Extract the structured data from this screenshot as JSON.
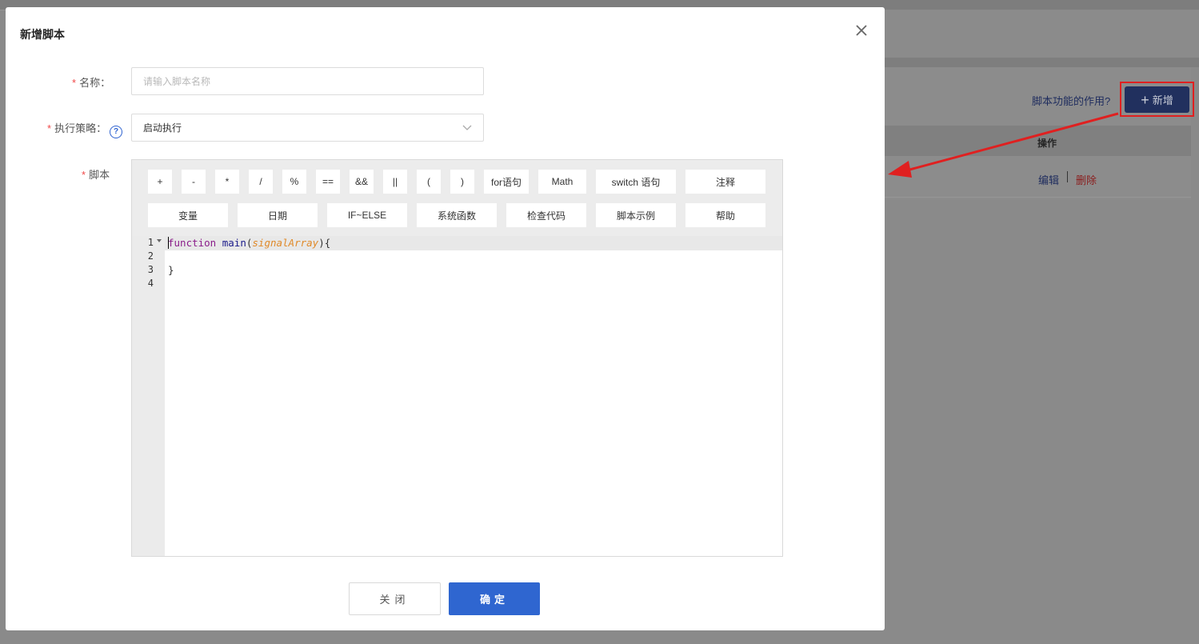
{
  "modal": {
    "title": "新增脚本",
    "close_icon": "close-icon"
  },
  "form": {
    "name_label": "名称：",
    "name_placeholder": "请输入脚本名称",
    "name_value": "",
    "strategy_label": "执行策略：",
    "strategy_help": "?",
    "strategy_value": "启动执行",
    "script_label": "脚本",
    "required_mark": "*"
  },
  "toolbar": {
    "row1": [
      "+",
      "-",
      "*",
      "/",
      "%",
      "==",
      "&&",
      "||",
      "(",
      ")",
      "for语句",
      "Math",
      "switch 语句",
      "注释"
    ],
    "row2": [
      "变量",
      "日期",
      "IF~ELSE",
      "系统函数",
      "检查代码",
      "脚本示例",
      "帮助"
    ]
  },
  "editor": {
    "line_numbers": [
      "1",
      "2",
      "3",
      "4"
    ],
    "code": {
      "kw_function": "function",
      "fn_main": "main",
      "open_paren": "(",
      "param": "signalArray",
      "close_paren_brace": "){",
      "line3": "}"
    }
  },
  "footer": {
    "close_label": "关闭",
    "ok_label": "确定"
  },
  "background": {
    "help_link": "脚本功能的作用?",
    "add_button": "新增",
    "column_operation": "操作",
    "edit_link": "编辑",
    "delete_link": "删除"
  },
  "colors": {
    "primary": "#2f66d0",
    "required": "#f04848",
    "annotation_red": "#e02020"
  }
}
